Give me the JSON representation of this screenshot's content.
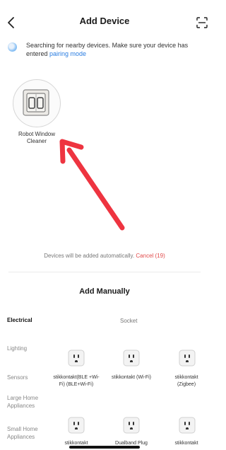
{
  "header": {
    "title": "Add Device"
  },
  "search": {
    "text": "Searching for nearby devices. Make sure your device has entered ",
    "link": "pairing mode"
  },
  "found_device": {
    "name_line1": "Robot Window",
    "name_line2": "Cleaner"
  },
  "auto_add": {
    "text": "Devices will be added automatically.",
    "cancel": "Cancel (19)"
  },
  "manual": {
    "title": "Add Manually",
    "categories": [
      "Electrical",
      "Lighting",
      "Sensors",
      "Large Home Appliances",
      "Small Home Appliances"
    ],
    "section_heading": "Socket",
    "products": [
      {
        "label": "stikkontakt(BLE +Wi-Fi) (BLE+Wi-Fi)"
      },
      {
        "label": "stikkontakt (Wi-Fi)"
      },
      {
        "label": "stikkontakt (Zigbee)"
      },
      {
        "label": "stikkontakt"
      },
      {
        "label": "Dualband Plug"
      },
      {
        "label": "stikkontakt"
      }
    ]
  },
  "colors": {
    "link": "#2a7de1",
    "cancel": "#e14a4a",
    "arrow": "#ee3440"
  }
}
